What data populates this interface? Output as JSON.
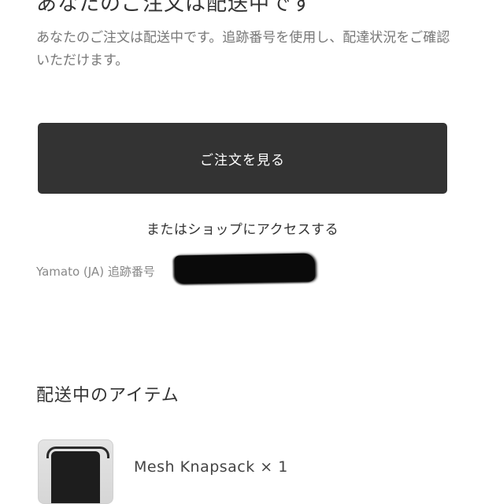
{
  "header": {
    "title": "あなたのご注文は配送中です"
  },
  "intro": {
    "text": "あなたのご注文は配送中です。追跡番号を使用し、配達状況をご確認いただけます。"
  },
  "actions": {
    "view_order_label": "ご注文を見る",
    "shop_link_label": "またはショップにアクセスする"
  },
  "tracking": {
    "label": "Yamato (JA) 追跡番号"
  },
  "items_section": {
    "title": "配送中のアイテム",
    "items": [
      {
        "name": "Mesh Knapsack × 1"
      }
    ]
  },
  "colors": {
    "button_bg": "#333333",
    "button_text": "#ffffff",
    "muted_text": "#777777"
  }
}
